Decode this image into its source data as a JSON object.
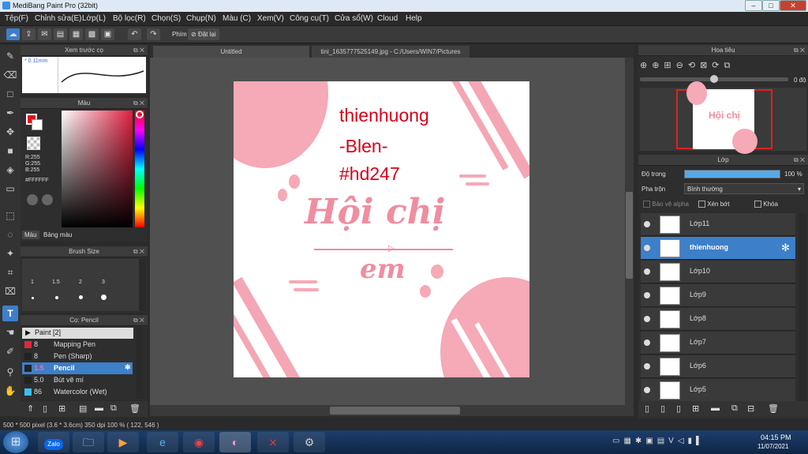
{
  "window": {
    "title": "MediBang Paint Pro (32bit)"
  },
  "menu": [
    "Tệp(F)",
    "Chỉnh sửa(E)",
    "Lớp(L)",
    "Bộ lọc(R)",
    "Chọn(S)",
    "Chụp(N)",
    "Màu (C)",
    "Xem(V)",
    "Công cụ(T)",
    "Cửa sổ(W)",
    "Cloud",
    "Help"
  ],
  "toolbar": {
    "phim_label": "Phím",
    "reset_label": "Đặt lại"
  },
  "preview_panel": {
    "title": "Xem trước cọ",
    "size": "0.11mm"
  },
  "color_panel": {
    "title": "Màu",
    "r": "R:255",
    "g": "G:255",
    "b": "B:255",
    "hex": "#FFFFFF",
    "tabs": [
      "Màu",
      "Bảng màu"
    ],
    "primary_color": "#e01020"
  },
  "brushsize_panel": {
    "title": "Brush Size",
    "sizes": [
      "1",
      "1.5",
      "2",
      "3"
    ]
  },
  "brush_panel": {
    "title": "Cọ: Pencil",
    "group": "Paint [2]",
    "items": [
      {
        "size": "8",
        "name": "Mapping Pen",
        "color": "#e0283a"
      },
      {
        "size": "8",
        "name": "Pen (Sharp)",
        "color": "#222222"
      },
      {
        "size": "1.5",
        "name": "Pencil",
        "color": "#222222"
      },
      {
        "size": "5.0",
        "name": "Bút vẽ mí",
        "color": "#222222"
      },
      {
        "size": "86",
        "name": "Watercolor (Wet)",
        "color": "#39c0f0"
      }
    ]
  },
  "tabs": [
    {
      "label": "Untitled"
    },
    {
      "label": "tini_1635777525149.jpg - C:/Users/WIN7/Pictures"
    }
  ],
  "artwork": {
    "line1": "thienhuong",
    "line2": "-Blen-",
    "line3": "#hd247",
    "title1": "Hội chị",
    "title2": "em",
    "text_color": "#d8001a",
    "pink": "#f4a6b4"
  },
  "navigator": {
    "title": "Hoa tiêu",
    "zoom": "0 độ"
  },
  "layer_panel": {
    "title": "Lớp",
    "opacity_label": "Độ trong",
    "opacity_value": "100 %",
    "opacity": 100,
    "blend_label": "Pha trộn",
    "blend_value": "Bình thường",
    "protect_alpha": "Bảo vệ alpha",
    "clipping": "Xén bớt",
    "lock": "Khóa",
    "layers": [
      "Lớp11",
      "thienhuong",
      "Lớp10",
      "Lớp9",
      "Lớp8",
      "Lớp7",
      "Lớp6",
      "Lớp5"
    ]
  },
  "status": {
    "info": "500 * 500 pixel  (3.6 * 3.6cm)  350 dpi  100 %  ( 122, 546 )"
  },
  "taskbar": {
    "time": "04:15 PM",
    "date": "11/07/2021",
    "zalo": "Zalo"
  }
}
